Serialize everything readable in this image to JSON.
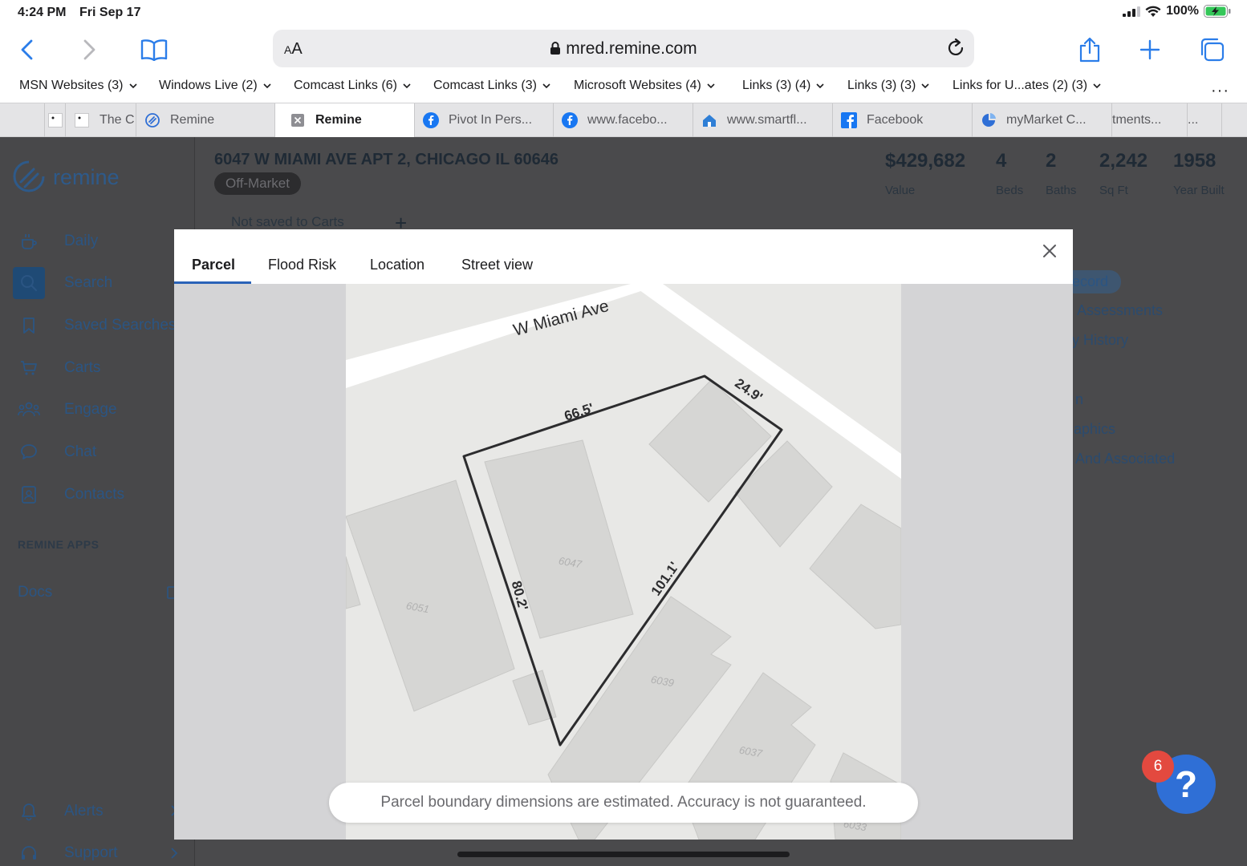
{
  "status": {
    "time": "4:24 PM",
    "date": "Fri Sep 17",
    "battery": "100%"
  },
  "browser": {
    "url": "mred.remine.com",
    "text_size_label_small": "A",
    "text_size_label_large": "A",
    "bookmarks": [
      "MSN Websites (3)",
      "Windows Live (2)",
      "Comcast Links (6)",
      "Comcast Links (3)",
      "Microsoft Websites (4)",
      "Links (3) (4)",
      "Links (3) (3)",
      "Links for U...ates (2) (3)"
    ],
    "more": "···",
    "tabs": [
      "The C",
      "Remine",
      "Remine",
      "Pivot In Pers...",
      "www.facebo...",
      "www.smartfl...",
      "Facebook",
      "myMarket C...",
      "tments...",
      "..."
    ]
  },
  "app": {
    "logo": "remine",
    "nav": [
      "Daily",
      "Search",
      "Saved Searches",
      "Carts",
      "Engage",
      "Chat",
      "Contacts"
    ],
    "section_label": "REMINE APPS",
    "apps": [
      "Docs"
    ],
    "bottom_nav": [
      "Alerts",
      "Support"
    ],
    "property": {
      "address": "6047 W MIAMI AVE APT 2, CHICAGO IL 60646",
      "status": "Off-Market",
      "carts_note": "Not saved to Carts",
      "add": "+",
      "stats": [
        {
          "value": "$429,682",
          "label": "Value"
        },
        {
          "value": "4",
          "label": "Beds"
        },
        {
          "value": "2",
          "label": "Baths"
        },
        {
          "value": "2,242",
          "label": "Sq Ft"
        },
        {
          "value": "1958",
          "label": "Year Built"
        }
      ]
    },
    "right_panel": {
      "pill": "ecord",
      "links": [
        "Assessments",
        "y History",
        "n",
        "aphics",
        "And Associated"
      ]
    }
  },
  "modal": {
    "tabs": [
      "Parcel",
      "Flood Risk",
      "Location",
      "Street view"
    ],
    "active_tab": "Parcel",
    "map": {
      "street": "W Miami Ave",
      "dimensions": [
        "66.5'",
        "24.9'",
        "80.2'",
        "101.1'"
      ],
      "building_numbers": [
        "6047",
        "6051",
        "6039",
        "6037",
        "6033"
      ]
    },
    "disclaimer": "Parcel boundary dimensions are estimated. Accuracy is not guaranteed."
  },
  "help": {
    "label": "?",
    "badge": "6"
  },
  "colors": {
    "accent": "#2a63b8",
    "help": "#2f6fd6",
    "badge": "#e3493f",
    "link": "#2b7de9"
  }
}
